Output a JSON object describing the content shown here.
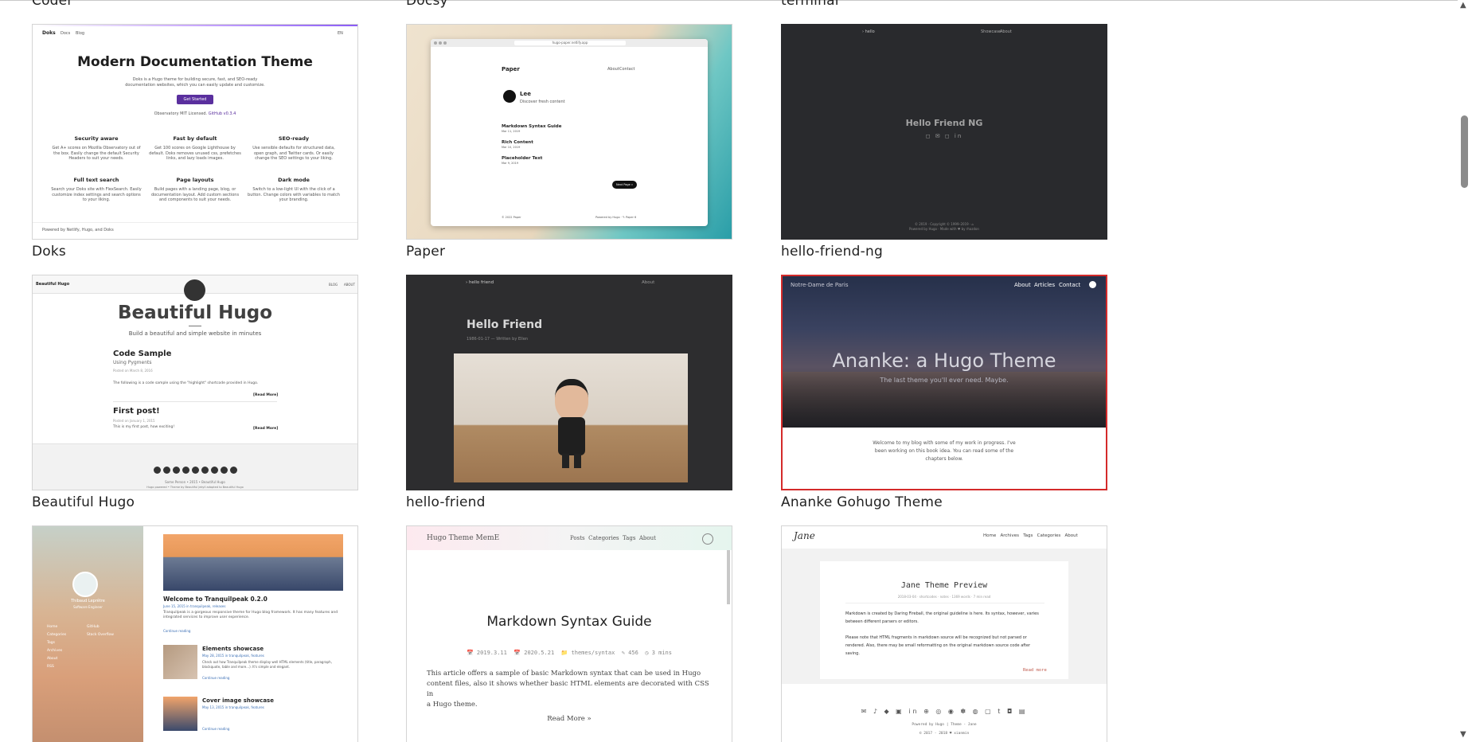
{
  "theme_gallery": {
    "row0": [
      "Coder",
      "Docsy",
      "terminal"
    ],
    "cards": [
      {
        "name": "Doks"
      },
      {
        "name": "Paper"
      },
      {
        "name": "hello-friend-ng"
      },
      {
        "name": "Beautiful Hugo"
      },
      {
        "name": "hello-friend"
      },
      {
        "name": "Ananke Gohugo Theme",
        "selected": true
      },
      {
        "name": "Tranquilpeak"
      },
      {
        "name": "Hugo Theme MemE"
      },
      {
        "name": "Jane"
      }
    ]
  },
  "doks": {
    "brand": "Doks",
    "nav": [
      "Docs",
      "Blog"
    ],
    "lang": "EN",
    "title": "Modern Documentation Theme",
    "desc1": "Doks is a Hugo theme for building secure, fast, and SEO-ready",
    "desc2": "documentation websites, which you can easily update and customize.",
    "cta": "Get Started",
    "meta_a": "Observatory MIT Licensed.",
    "meta_b": "GitHub v0.3.4",
    "features": [
      {
        "title": "Security aware",
        "text": "Get A+ scores on Mozilla Observatory out of the box. Easily change the default Security Headers to suit your needs."
      },
      {
        "title": "Fast by default",
        "text": "Get 100 scores on Google Lighthouse by default. Doks removes unused css, prefetches links, and lazy loads images."
      },
      {
        "title": "SEO-ready",
        "text": "Use sensible defaults for structured data, open graph, and Twitter cards. Or easily change the SEO settings to your liking."
      },
      {
        "title": "Full text search",
        "text": "Search your Doks site with FlexSearch. Easily customize index settings and search options to your liking."
      },
      {
        "title": "Page layouts",
        "text": "Build pages with a landing page, blog, or documentation layout. Add custom sections and components to suit your needs."
      },
      {
        "title": "Dark mode",
        "text": "Switch to a low-light UI with the click of a button. Change colors with variables to match your branding."
      }
    ],
    "footer": "Powered by Netlify, Hugo, and Doks"
  },
  "paper": {
    "url": "hugo-paper.netlify.app",
    "brand": "Paper",
    "nav": [
      "About",
      "Contact"
    ],
    "author": "Lee",
    "author_sub": "Discover fresh content",
    "posts": [
      {
        "title": "Markdown Syntax Guide",
        "date": "Mar 11, 2019"
      },
      {
        "title": "Rich Content",
        "date": "Mar 10, 2019"
      },
      {
        "title": "Placeholder Text",
        "date": "Mar 9, 2019"
      }
    ],
    "next": "Next Page »",
    "footer_left": "© 2022 Paper",
    "footer_right": "Powered by Hugo · ✎ Paper 6"
  },
  "hfng": {
    "logo": "› hello",
    "nav": [
      "Showcase",
      "About"
    ],
    "title": "Hello Friend NG",
    "footer1": "© 2019 · Copyright © 1999–2019 · ⌂",
    "footer2": "Powered by Hugo · Made with ♥ by rhazdon"
  },
  "bhugo": {
    "site": "Beautiful Hugo",
    "nav": [
      "BLOG",
      "ABOUT"
    ],
    "title": "Beautiful Hugo",
    "subtitle": "Build a beautiful and simple website in minutes",
    "post1_title": "Code Sample",
    "post1_sub": "Using Pygments",
    "post1_date": "Posted on March 8, 2016",
    "post1_text": "The following is a code sample using the \"highlight\" shortcode provided in Hugo.",
    "read_more": "[Read More]",
    "post2_title": "First post!",
    "post2_date": "Posted on January 1, 2015",
    "post2_text": "This is my first post, how exciting!",
    "footer1": "Some Person • 2015 • Beautiful Hugo",
    "footer2": "Hugo powered • Theme by Beautiful Jekyll adapted to Beautiful Hugo"
  },
  "hf": {
    "logo": "› hello friend",
    "nav": "About",
    "title": "Hello Friend",
    "meta": "1986-01-17 — Written by Ellen"
  },
  "ananke": {
    "site": "Notre-Dame de Paris",
    "nav": [
      "About",
      "Articles",
      "Contact"
    ],
    "title": "Ananke: a Hugo Theme",
    "subtitle": "The last theme you'll ever need. Maybe.",
    "body1": "Welcome to my blog with some of my work in progress. I've",
    "body2": "been working on this book idea. You can read some of the",
    "body3": "chapters below."
  },
  "tranquil": {
    "author": "Thibaud Leprêtre",
    "job": "Software Engineer",
    "menu": [
      "Home",
      "Categories",
      "Tags",
      "Archives",
      "About",
      "RSS"
    ],
    "menu_right": [
      "GitHub",
      "Stack Overflow"
    ],
    "post1_title": "Welcome to Tranquilpeak 0.2.0",
    "post1_meta": "June 15, 2015 in tranquilpeak, releases",
    "post1_text": "Tranquilpeak is a gorgeous responsive theme for Hugo blog framework. It has many features and integrated services to improve user experience.",
    "continue": "Continue reading",
    "post2_title": "Elements showcase",
    "post2_meta": "May 28, 2015 in tranquilpeak, features",
    "post2_text": "Check out how Tranquilpeak theme display well HTML elements (title, paragraph, blockquote, table and more...). It's simple and elegant.",
    "post3_title": "Cover image showcase",
    "post3_meta": "May 13, 2015 in tranquilpeak, features"
  },
  "meme": {
    "site": "Hugo Theme MemE",
    "nav": [
      "Posts",
      "Categories",
      "Tags",
      "About"
    ],
    "title": "Markdown Syntax Guide",
    "meta": [
      "📅 2019.3.11",
      "📅 2020.5.21",
      "📁 themes/syntax",
      "✎ 456",
      "◷ 3 mins"
    ],
    "body1": "This article offers a sample of basic Markdown syntax that can be used in Hugo",
    "body2": "content files, also it shows whether basic HTML elements are decorated with CSS in",
    "body3": "a Hugo theme.",
    "read_more": "Read More »"
  },
  "jane": {
    "logo": "Jane",
    "nav": [
      "Home",
      "Archives",
      "Tags",
      "Categories",
      "About"
    ],
    "title": "Jane Theme Preview",
    "meta": "2018-03-04 · shortcodes · notes · 1369 words · 7 min read",
    "p1": "Markdown is created by Daring Fireball, the original guideline is here. Its syntax, however, varies between different parsers or editors.",
    "p2": "Please note that HTML fragments in markdown source will be recognized but not parsed or rendered. Also, there may be small reformatting on the original markdown source code after saving.",
    "read_more": "Read more",
    "footer1": "Powered by Hugo | Theme - Jane",
    "footer2": "© 2017 - 2018 ♥ xianmin"
  },
  "colors": {
    "selected_border": "#d42a2a",
    "doks_btn": "#5a2f9e",
    "jane_link": "#c05b4d"
  }
}
